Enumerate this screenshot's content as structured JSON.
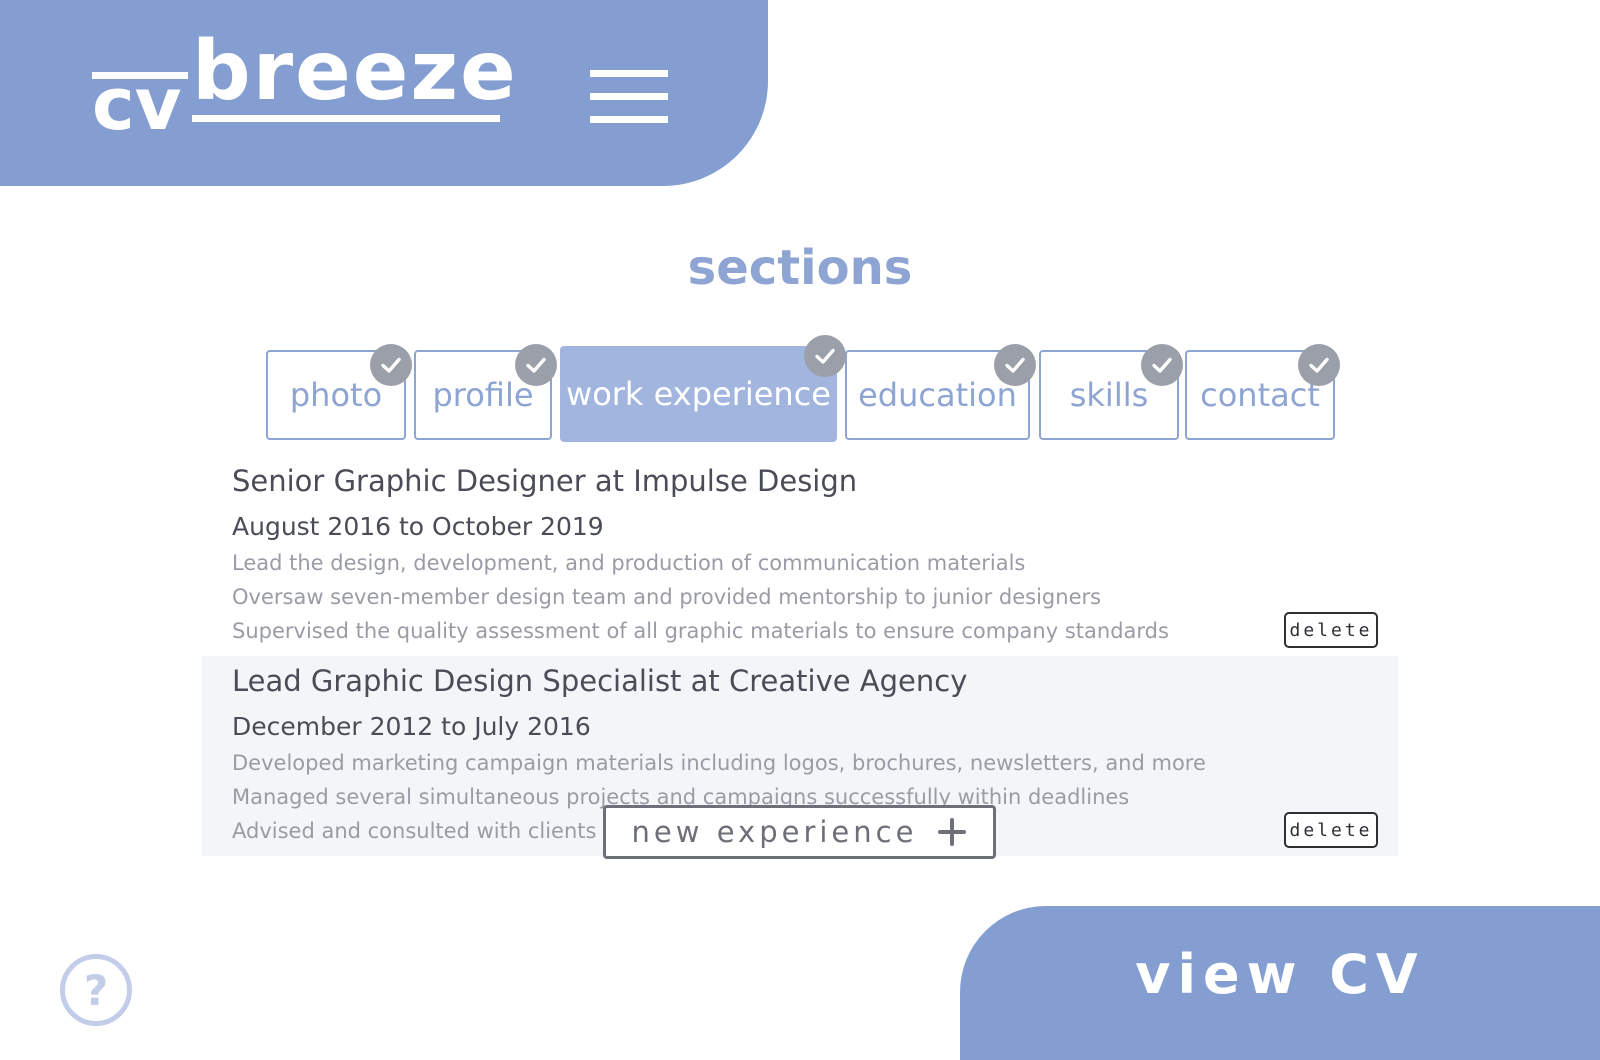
{
  "header": {
    "logo_cv": "cv",
    "logo_breeze": "breeze",
    "menu_icon": "hamburger-menu-icon"
  },
  "colors": {
    "brand": "#849ed1",
    "tab_active": "#a2b5df",
    "check_badge": "#9a9faa",
    "help": "#c3cdea"
  },
  "sections_title": "sections",
  "tabs": [
    {
      "label": "photo",
      "active": false,
      "completed": true
    },
    {
      "label": "profile",
      "active": false,
      "completed": true
    },
    {
      "label": "work experience",
      "active": true,
      "completed": true
    },
    {
      "label": "education",
      "active": false,
      "completed": true
    },
    {
      "label": "skills",
      "active": false,
      "completed": true
    },
    {
      "label": "contact",
      "active": false,
      "completed": true
    }
  ],
  "experiences": [
    {
      "title": "Senior Graphic Designer at Impulse Design",
      "dates": "August 2016 to October 2019",
      "bullets": [
        "Lead the design, development, and production of communication materials",
        "Oversaw seven-member design team and provided mentorship to junior designers",
        "Supervised the quality assessment of all graphic materials to ensure company standards"
      ],
      "delete_label": "delete"
    },
    {
      "title": "Lead Graphic Design Specialist at Creative Agency",
      "dates": "December 2012 to July 2016",
      "bullets": [
        "Developed marketing campaign materials including logos, brochures, newsletters, and more",
        "Managed several simultaneous projects and campaigns successfully within deadlines",
        "Advised and consulted with clients to determine their budgets and goals"
      ],
      "delete_label": "delete"
    }
  ],
  "new_experience_label": "new experience",
  "help_label": "?",
  "view_cv_label": "view CV"
}
